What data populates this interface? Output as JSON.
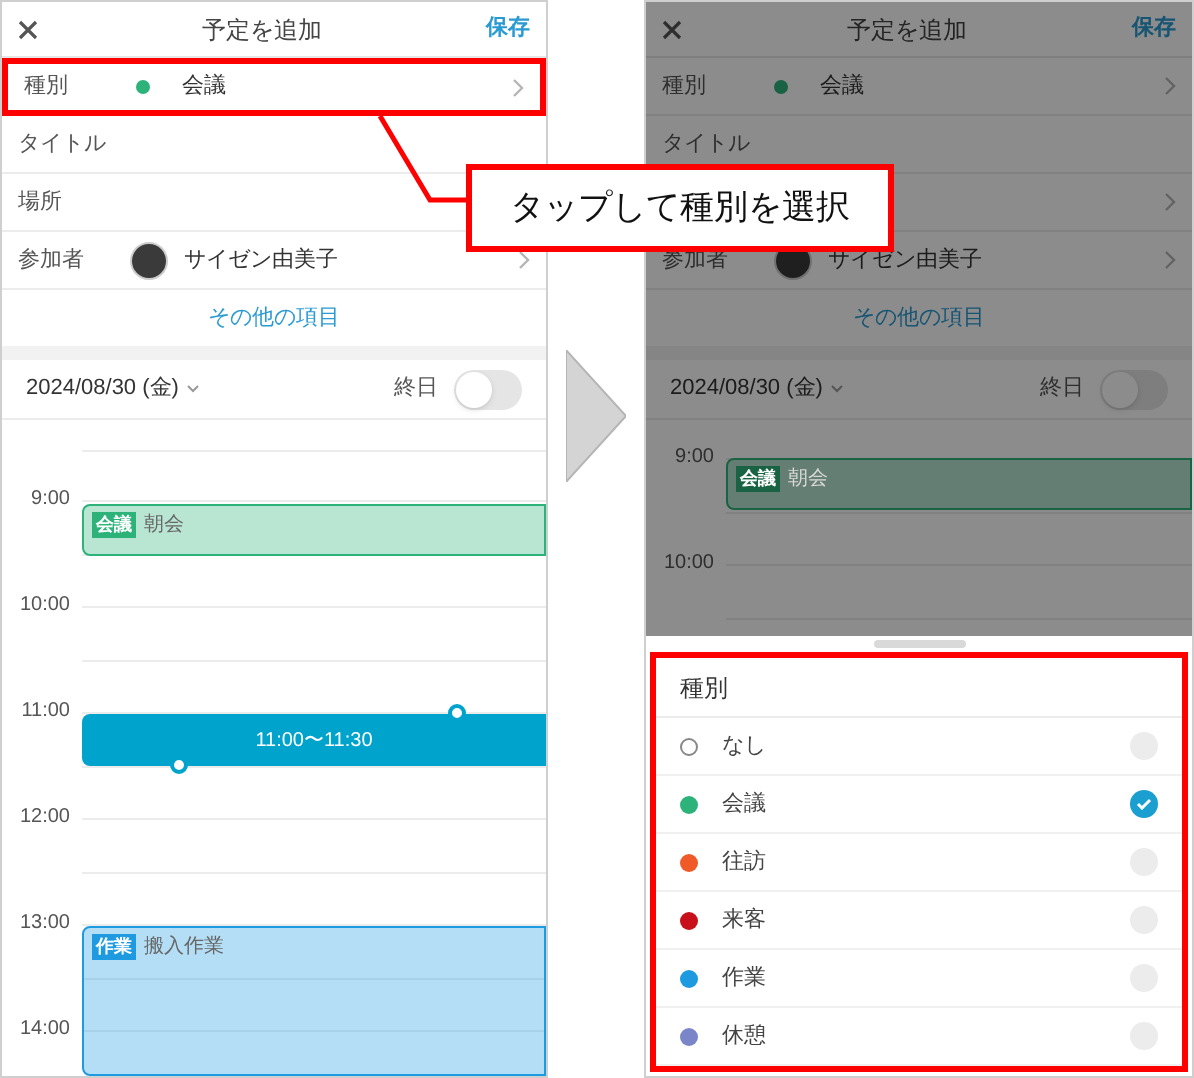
{
  "left_screen": {
    "header": {
      "title": "予定を追加",
      "save": "保存"
    },
    "rows": [
      {
        "label": "種別",
        "value": "会議",
        "color": "#2db37a",
        "kind": "category",
        "chevron": true,
        "highlighted": true
      },
      {
        "label": "タイトル",
        "kind": "text",
        "chevron": false,
        "highlighted": false
      },
      {
        "label": "場所",
        "kind": "text",
        "chevron": false,
        "highlighted": false
      },
      {
        "label": "参加者",
        "value": "サイゼン由美子",
        "kind": "person",
        "chevron": true,
        "highlighted": false
      }
    ],
    "more_link": "その他の項目",
    "date": "2024/08/30 (金)",
    "all_day": {
      "label": "終日",
      "on": false
    },
    "hours": [
      "9:00",
      "10:00",
      "11:00",
      "12:00",
      "13:00",
      "14:00"
    ],
    "events": [
      {
        "kind": "event",
        "tag": "会議",
        "title": "朝会",
        "color": "#2db37a"
      },
      {
        "kind": "selection",
        "title": "11:00〜11:30"
      },
      {
        "kind": "event",
        "tag": "作業",
        "title": "搬入作業",
        "color": "#1e9be0"
      }
    ]
  },
  "callout": "タップして種別を選択",
  "right_screen": {
    "header": {
      "title": "予定を追加",
      "save": "保存"
    },
    "rows": [
      {
        "label": "種別",
        "value": "会議",
        "color": "#196243",
        "kind": "category",
        "chevron": true,
        "highlighted": false
      },
      {
        "label": "タイトル",
        "kind": "text",
        "chevron": false,
        "highlighted": false
      },
      {
        "kind": "text",
        "chevron": true,
        "highlighted": false
      },
      {
        "label": "参加者",
        "value": "サイゼン由美子",
        "kind": "person",
        "chevron": true,
        "highlighted": false
      }
    ],
    "more_link": "その他の項目",
    "date": "2024/08/30 (金)",
    "all_day": {
      "label": "終日",
      "on": false
    },
    "hours": [
      "9:00",
      "10:00"
    ],
    "events": [
      {
        "kind": "event",
        "tag": "会議",
        "title": "朝会",
        "color": "#196243"
      }
    ]
  },
  "sheet": {
    "title": "種別",
    "options": [
      {
        "label": "なし",
        "selected": false
      },
      {
        "label": "会議",
        "color": "#2db37a",
        "selected": true
      },
      {
        "label": "往訪",
        "color": "#f05a28",
        "selected": false
      },
      {
        "label": "来客",
        "color": "#c8101a",
        "selected": false
      },
      {
        "label": "作業",
        "color": "#1e9be0",
        "selected": false
      },
      {
        "label": "休憩",
        "color": "#7b86c8",
        "selected": false
      }
    ]
  }
}
